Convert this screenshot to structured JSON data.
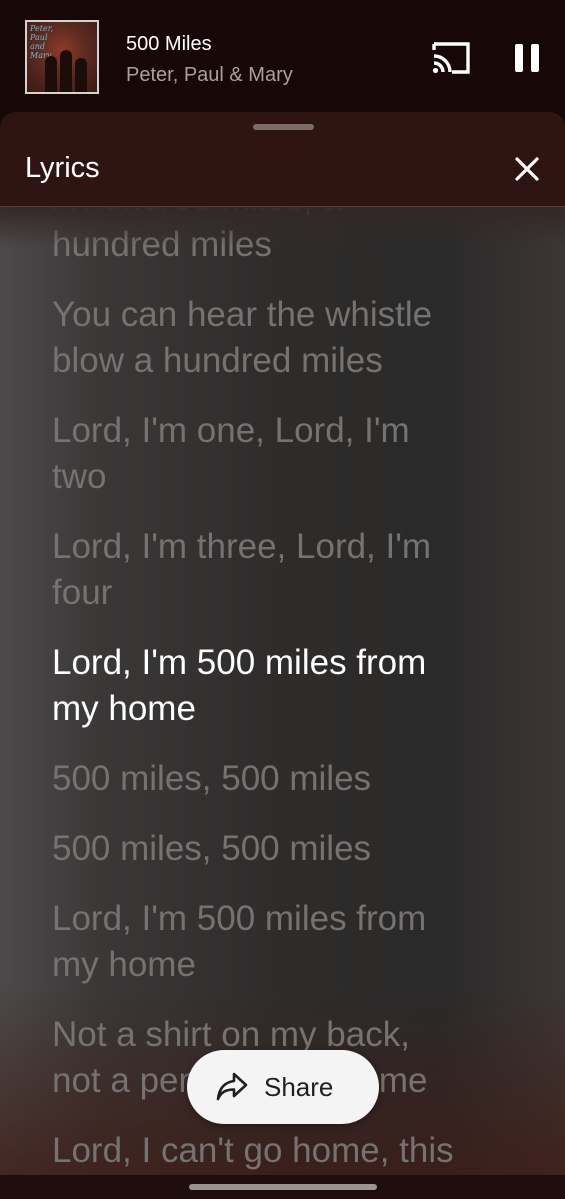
{
  "mini_player": {
    "track_title": "500 Miles",
    "artist": "Peter, Paul & Mary",
    "album_art_text": "Peter, Paul and Mary",
    "cast_icon": "cast-icon",
    "pause_icon": "pause-icon"
  },
  "lyrics_panel": {
    "title": "Lyrics",
    "close_icon": "close-icon",
    "lines": [
      {
        "text": "A hundred miles, a\nhundred miles",
        "active": false
      },
      {
        "text": "You can hear the whistle\nblow a hundred miles",
        "active": false
      },
      {
        "text": "Lord, I'm one, Lord, I'm\ntwo",
        "active": false
      },
      {
        "text": "Lord, I'm three, Lord, I'm\nfour",
        "active": false
      },
      {
        "text": "Lord, I'm 500 miles from\nmy home",
        "active": true
      },
      {
        "text": "500 miles, 500 miles",
        "active": false
      },
      {
        "text": "500 miles, 500 miles",
        "active": false
      },
      {
        "text": "Lord, I'm 500 miles from\nmy home",
        "active": false
      },
      {
        "text": "Not a shirt on my back,\nnot a penny to my name",
        "active": false
      },
      {
        "text": "Lord, I can't go home, this\na-way",
        "active": false
      }
    ],
    "share_label": "Share",
    "share_icon": "share-icon"
  },
  "colors": {
    "active_line": "#ffffff",
    "inactive_line": "#757271",
    "header_bg": "#2e1511"
  }
}
